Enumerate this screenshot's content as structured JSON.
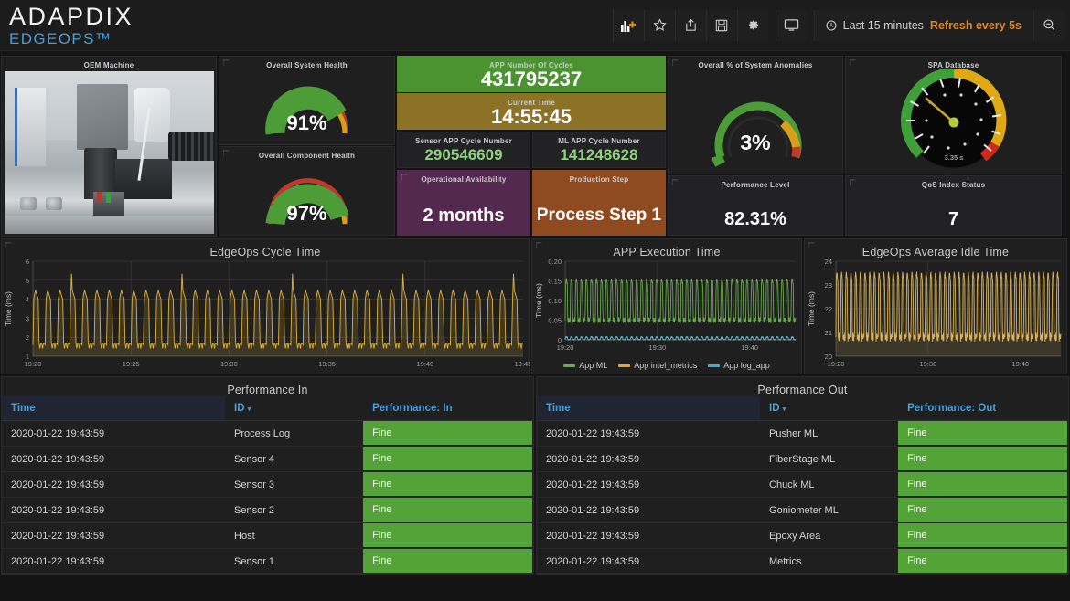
{
  "brand": {
    "name": "ADAPDIX",
    "product": "EDGEOPS™"
  },
  "toolbar": {
    "add_panel_label": "add-panel",
    "star_label": "star",
    "share_label": "share",
    "save_label": "save",
    "settings_label": "settings",
    "tv_label": "tv-mode",
    "time_range": "Last 15 minutes",
    "refresh": "Refresh every 5s",
    "search_label": "search"
  },
  "panels": {
    "machine": {
      "title": "OEM Machine"
    },
    "system_health": {
      "title": "Overall System Health",
      "value": "91%",
      "percent": 91
    },
    "component_health": {
      "title": "Overall Component Health",
      "value": "97%",
      "percent": 97
    },
    "cycles": {
      "title": "APP Number Of Cycles",
      "value": "431795237",
      "color": "#4a9330"
    },
    "current_time": {
      "title": "Current Time",
      "value": "14:55:45",
      "color": "#8c7226"
    },
    "sensor_cycle": {
      "title": "Sensor APP Cycle Number",
      "value": "290546609"
    },
    "ml_cycle": {
      "title": "ML APP Cycle Number",
      "value": "141248628"
    },
    "availability": {
      "title": "Operational Availability",
      "value": "2 months",
      "color": "#54294f"
    },
    "production_step": {
      "title": "Production Step",
      "value": "Process Step 1",
      "color": "#8f4a20"
    },
    "anomalies": {
      "title": "Overall % of System Anomalies",
      "value": "3%",
      "percent": 3
    },
    "spa_database": {
      "title": "SPA Database",
      "value": "3.35 s"
    },
    "performance_level": {
      "title": "Performance Level",
      "value": "82.31%"
    },
    "qos_index": {
      "title": "QoS Index Status",
      "value": "7"
    }
  },
  "chart_data": [
    {
      "type": "line",
      "title": "EdgeOps Cycle Time",
      "ylabel": "Time (ms)",
      "xlabel": "",
      "ylim": [
        1,
        6
      ],
      "yticks": [
        1,
        2,
        3,
        4,
        5,
        6
      ],
      "xticks": [
        "19:20",
        "19:25",
        "19:30",
        "19:35",
        "19:40",
        "19:45"
      ],
      "grid": true,
      "series": [
        {
          "name": "Cycle Time",
          "color": "#e0b33c",
          "low": 1.6,
          "high": 4.3,
          "cycles": 40,
          "spikes": [
            5.4,
            5.3,
            4.9
          ]
        }
      ]
    },
    {
      "type": "line",
      "title": "APP Execution Time",
      "ylabel": "Time (ms)",
      "xlabel": "",
      "ylim": [
        0,
        0.2
      ],
      "yticks": [
        "0",
        "0.05",
        "0.10",
        "0.15",
        "0.20"
      ],
      "xticks": [
        "19:20",
        "19:30",
        "19:40"
      ],
      "grid": true,
      "legend_position": "bottom",
      "series": [
        {
          "name": "App ML",
          "color": "#6aa84f",
          "low": 0.05,
          "high": 0.15
        },
        {
          "name": "App intel_metrics",
          "color": "#e0a83c",
          "low": 0.0,
          "high": 0.005
        },
        {
          "name": "App log_app",
          "color": "#4aa8c8",
          "low": 0.0,
          "high": 0.008
        }
      ]
    },
    {
      "type": "line",
      "title": "EdgeOps Average Idle Time",
      "ylabel": "Time (ms)",
      "xlabel": "",
      "ylim": [
        20,
        24
      ],
      "yticks": [
        20,
        21,
        22,
        23,
        24
      ],
      "xticks": [
        "19:20",
        "19:30",
        "19:40"
      ],
      "grid": true,
      "series": [
        {
          "name": "Idle Time",
          "color": "#d8b45c",
          "low": 20.8,
          "high": 23.4,
          "cycles": 48
        }
      ]
    }
  ],
  "tables": {
    "performance_in": {
      "title": "Performance In",
      "columns": [
        "Time",
        "ID",
        "Performance: In"
      ],
      "rows": [
        {
          "time": "2020-01-22 19:43:59",
          "id": "Process Log",
          "status": "Fine"
        },
        {
          "time": "2020-01-22 19:43:59",
          "id": "Sensor 4",
          "status": "Fine"
        },
        {
          "time": "2020-01-22 19:43:59",
          "id": "Sensor 3",
          "status": "Fine"
        },
        {
          "time": "2020-01-22 19:43:59",
          "id": "Sensor 2",
          "status": "Fine"
        },
        {
          "time": "2020-01-22 19:43:59",
          "id": "Host",
          "status": "Fine"
        },
        {
          "time": "2020-01-22 19:43:59",
          "id": "Sensor 1",
          "status": "Fine"
        }
      ]
    },
    "performance_out": {
      "title": "Performance Out",
      "columns": [
        "Time",
        "ID",
        "Performance: Out"
      ],
      "rows": [
        {
          "time": "2020-01-22 19:43:59",
          "id": "Pusher ML",
          "status": "Fine"
        },
        {
          "time": "2020-01-22 19:43:59",
          "id": "FiberStage ML",
          "status": "Fine"
        },
        {
          "time": "2020-01-22 19:43:59",
          "id": "Chuck ML",
          "status": "Fine"
        },
        {
          "time": "2020-01-22 19:43:59",
          "id": "Goniometer ML",
          "status": "Fine"
        },
        {
          "time": "2020-01-22 19:43:59",
          "id": "Epoxy Area",
          "status": "Fine"
        },
        {
          "time": "2020-01-22 19:43:59",
          "id": "Metrics",
          "status": "Fine"
        }
      ]
    }
  }
}
